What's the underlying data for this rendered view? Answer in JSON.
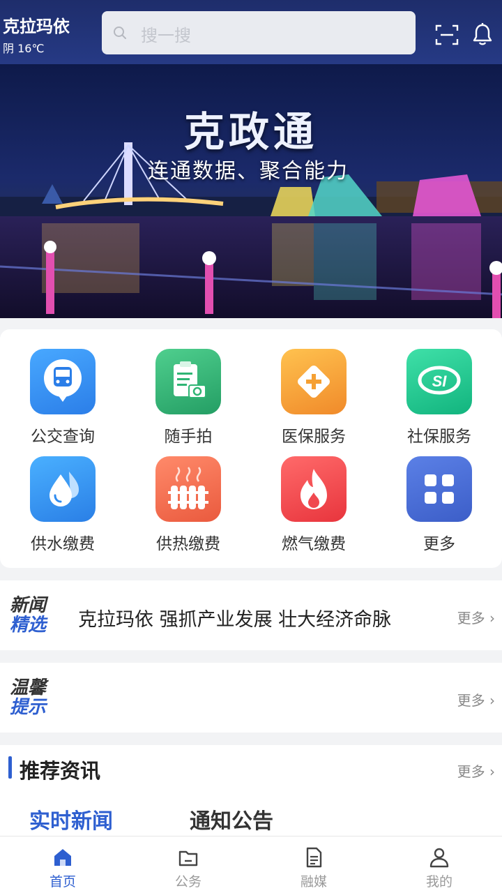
{
  "header": {
    "city": "克拉玛依",
    "weather": "阴 16℃",
    "search_placeholder": "搜一搜"
  },
  "banner": {
    "title": "克政通",
    "subtitle": "连通数据、聚合能力"
  },
  "services": [
    {
      "label": "公交查询",
      "icon": "bus-icon",
      "color": "#2f8cf0"
    },
    {
      "label": "随手拍",
      "icon": "clipboard-camera-icon",
      "color": "#2fb574"
    },
    {
      "label": "医保服务",
      "icon": "medical-cross-icon",
      "color": "#f5a033"
    },
    {
      "label": "社保服务",
      "icon": "social-security-icon",
      "color": "#18c98f"
    },
    {
      "label": "供水缴费",
      "icon": "water-drop-icon",
      "color": "#2f8cf0"
    },
    {
      "label": "供热缴费",
      "icon": "radiator-icon",
      "color": "#f46a4f"
    },
    {
      "label": "燃气缴费",
      "icon": "flame-icon",
      "color": "#f0484f"
    },
    {
      "label": "更多",
      "icon": "grid-icon",
      "color": "#4a6fd6"
    }
  ],
  "news": {
    "badge_line1": "新闻",
    "badge_line2": "精选",
    "headline": "克拉玛依 强抓产业发展 壮大经济命脉",
    "more": "更多"
  },
  "tips": {
    "badge_line1": "温馨",
    "badge_line2": "提示",
    "more": "更多"
  },
  "recommend": {
    "title": "推荐资讯",
    "more": "更多",
    "tabs": [
      "实时新闻",
      "通知公告"
    ],
    "active_tab": "实时新闻"
  },
  "nav": {
    "items": [
      "首页",
      "公务",
      "融媒",
      "我的"
    ],
    "active": "首页"
  },
  "colors": {
    "accent": "#2e5fd0",
    "header_bg": "#1e2d6b"
  }
}
